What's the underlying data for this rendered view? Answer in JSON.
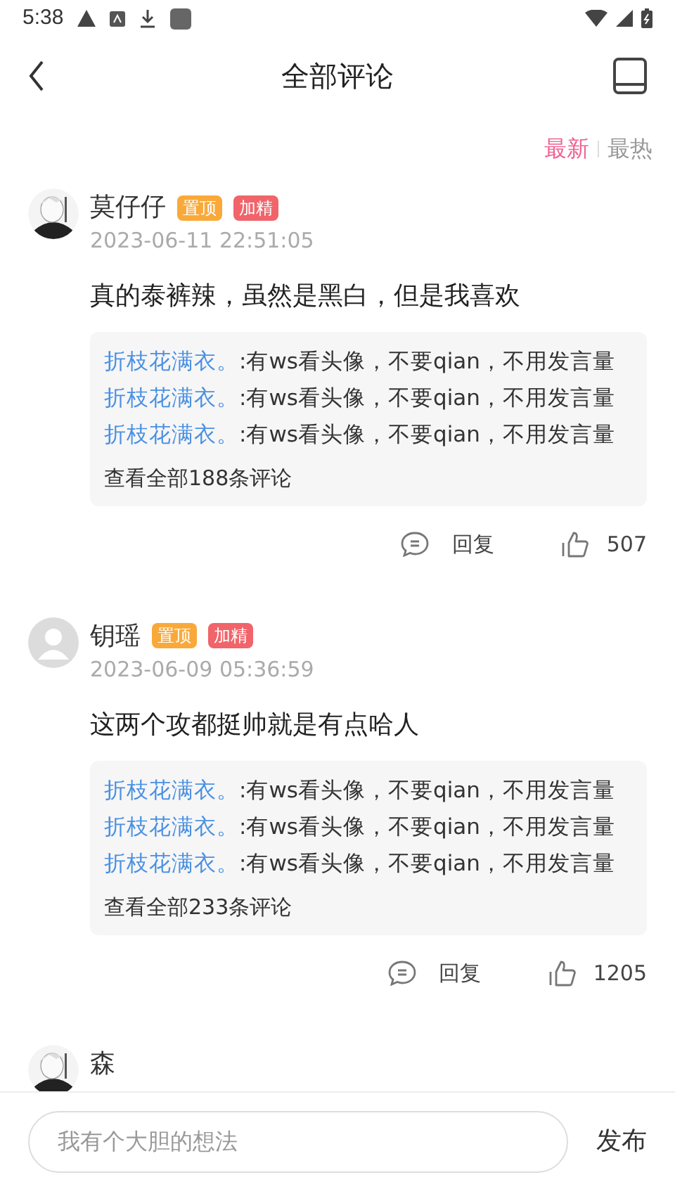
{
  "status_bar": {
    "time": "5:38"
  },
  "header": {
    "title": "全部评论"
  },
  "sort_tabs": [
    {
      "label": "最新",
      "selected": true
    },
    {
      "label": "最热",
      "selected": false
    }
  ],
  "comments": [
    {
      "avatar": {
        "kind": "picture"
      },
      "user": "莫仔仔",
      "badges": [
        {
          "label": "置顶",
          "color": "#f9a93a"
        },
        {
          "label": "加精",
          "color": "#f0646a"
        }
      ],
      "time": "2023-06-11 22:51:05",
      "text": "真的泰裤辣，虽然是黑白，但是我喜欢",
      "replies": [
        {
          "user": "折枝花满衣。",
          "text": ":有ws看头像，不要qian，不用发言量"
        },
        {
          "user": "折枝花满衣。",
          "text": ":有ws看头像，不要qian，不用发言量"
        },
        {
          "user": "折枝花满衣。",
          "text": ":有ws看头像，不要qian，不用发言量"
        }
      ],
      "more": "查看全部188条评论",
      "reply_label": "回复",
      "likes": "507"
    },
    {
      "avatar": {
        "kind": "default"
      },
      "user": "钥瑶",
      "badges": [
        {
          "label": "置顶",
          "color": "#f9a93a"
        },
        {
          "label": "加精",
          "color": "#f0646a"
        }
      ],
      "time": "2023-06-09 05:36:59",
      "text": "这两个攻都挺帅就是有点哈人",
      "replies": [
        {
          "user": "折枝花满衣。",
          "text": ":有ws看头像，不要qian，不用发言量"
        },
        {
          "user": "折枝花满衣。",
          "text": ":有ws看头像，不要qian，不用发言量"
        },
        {
          "user": "折枝花满衣。",
          "text": ":有ws看头像，不要qian，不用发言量"
        }
      ],
      "more": "查看全部233条评论",
      "reply_label": "回复",
      "likes": "1205"
    },
    {
      "avatar": {
        "kind": "picture"
      },
      "user": "森"
    }
  ],
  "composer": {
    "placeholder": "我有个大胆的想法",
    "submit": "发布"
  }
}
